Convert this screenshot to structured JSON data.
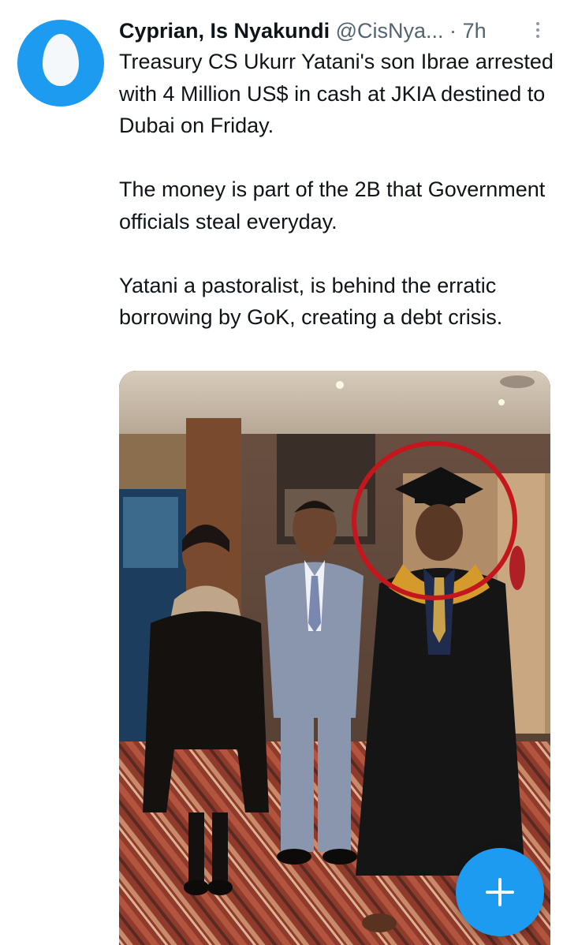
{
  "tweet": {
    "display_name": "Cyprian, Is Nyakundi",
    "handle": "@CisNya...",
    "separator": "·",
    "time": "7h",
    "paragraphs": [
      "Treasury CS Ukurr Yatani's son Ibrae arrested with 4 Million US$ in cash at JKIA destined to Dubai on Friday.",
      "The money is part of the 2B that Government officials steal everyday.",
      "Yatani a pastoralist, is behind the erratic borrowing by GoK, creating a debt crisis."
    ]
  },
  "icons": {
    "avatar": "default-egg-avatar-icon",
    "more": "more-options-icon",
    "compose": "compose-plus-icon"
  },
  "colors": {
    "accent": "#1d9bf0",
    "text": "#0f1419",
    "secondary_text": "#536471",
    "highlight_circle": "#c4161c"
  }
}
